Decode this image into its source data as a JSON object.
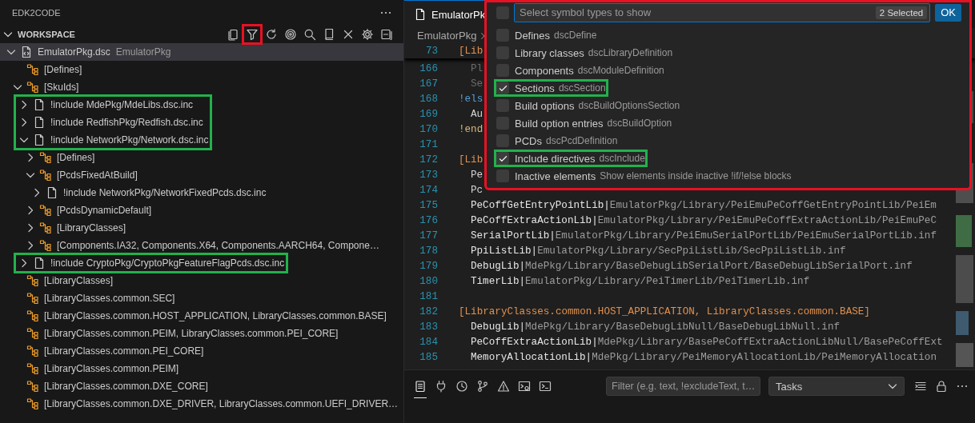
{
  "sidebar": {
    "title": "EDK2CODE",
    "section": {
      "title": "WORKSPACE",
      "expanded": true
    },
    "toolbar": [
      {
        "kind": "copy"
      },
      {
        "kind": "filter",
        "color": "#e81123"
      },
      {
        "kind": "refresh"
      },
      {
        "kind": "target"
      },
      {
        "kind": "search"
      },
      {
        "kind": "book"
      },
      {
        "kind": "close"
      },
      {
        "kind": "settings"
      },
      {
        "kind": "collapse"
      }
    ],
    "tree": [
      {
        "kind": "dsc",
        "label": "EmulatorPkg.dsc",
        "description": "EmulatorPkg",
        "expanded": true,
        "selected": true,
        "children": [
          {
            "kind": "section",
            "label": "[Defines]",
            "selected": false
          },
          {
            "kind": "section",
            "label": "[SkuIds]",
            "expanded": true,
            "selected": false,
            "children": [
              {
                "kind": "include",
                "label": "!include MdePkg/MdeLibs.dsc.inc",
                "expanded": false,
                "selected": false,
                "color": "#22b14c"
              },
              {
                "kind": "include",
                "label": "!include RedfishPkg/Redfish.dsc.inc",
                "expanded": false,
                "selected": false,
                "color": "#22b14c"
              },
              {
                "kind": "include",
                "label": "!include NetworkPkg/Network.dsc.inc",
                "expanded": true,
                "selected": false,
                "color": "#22b14c",
                "children": [
                  {
                    "kind": "section",
                    "label": "[Defines]",
                    "expanded": false,
                    "selected": false
                  },
                  {
                    "kind": "section",
                    "label": "[PcdsFixedAtBuild]",
                    "expanded": true,
                    "selected": false,
                    "children": [
                      {
                        "kind": "include",
                        "label": "!include NetworkPkg/NetworkFixedPcds.dsc.inc",
                        "expanded": false,
                        "selected": false
                      }
                    ]
                  },
                  {
                    "kind": "section",
                    "label": "[PcdsDynamicDefault]",
                    "expanded": false,
                    "selected": false
                  },
                  {
                    "kind": "section",
                    "label": "[LibraryClasses]",
                    "expanded": false,
                    "selected": false
                  },
                  {
                    "kind": "section",
                    "label": "[Components.IA32, Components.X64, Components.AARCH64, Compone…",
                    "expanded": false,
                    "selected": false
                  }
                ]
              },
              {
                "kind": "include",
                "label": "!include CryptoPkg/CryptoPkgFeatureFlagPcds.dsc.inc",
                "expanded": false,
                "selected": false,
                "color": "#22b14c"
              }
            ]
          },
          {
            "kind": "section",
            "label": "[LibraryClasses]",
            "selected": false
          },
          {
            "kind": "section",
            "label": "[LibraryClasses.common.SEC]",
            "selected": false
          },
          {
            "kind": "section",
            "label": "[LibraryClasses.common.HOST_APPLICATION, LibraryClasses.common.BASE]",
            "selected": false
          },
          {
            "kind": "section",
            "label": "[LibraryClasses.common.PEIM, LibraryClasses.common.PEI_CORE]",
            "selected": false
          },
          {
            "kind": "section",
            "label": "[LibraryClasses.common.PEI_CORE]",
            "selected": false
          },
          {
            "kind": "section",
            "label": "[LibraryClasses.common.PEIM]",
            "selected": false
          },
          {
            "kind": "section",
            "label": "[LibraryClasses.common.DXE_CORE]",
            "selected": false
          },
          {
            "kind": "section",
            "label": "[LibraryClasses.common.DXE_DRIVER, LibraryClasses.common.UEFI_DRIVER…",
            "selected": false
          }
        ]
      }
    ]
  },
  "editor": {
    "tab": "EmulatorPk",
    "breadcrumb": "EmulatorPkg",
    "sticky_line": {
      "num": "73",
      "kind": "section",
      "text": "[Lib"
    },
    "lines": [
      {
        "num": "166",
        "kind": "inactive",
        "text": "Pl"
      },
      {
        "num": "167",
        "kind": "inactive",
        "text": "Se"
      },
      {
        "num": "168",
        "kind": "directive",
        "text": "!els",
        "color": "#569cd6"
      },
      {
        "num": "169",
        "kind": "plain",
        "text": "Au"
      },
      {
        "num": "170",
        "kind": "directive",
        "text": "!end",
        "color": "#d7ba7d"
      },
      {
        "num": "171",
        "kind": "blank"
      },
      {
        "num": "172",
        "kind": "section",
        "text": "[Lib"
      },
      {
        "num": "173",
        "kind": "plain",
        "text": "Pe"
      },
      {
        "num": "174",
        "kind": "plain",
        "text": "Pc"
      },
      {
        "num": "175",
        "kind": "entry",
        "key": "PeCoffGetEntryPointLib|",
        "path": "EmulatorPkg/Library/PeiEmuPeCoffGetEntryPointLib/PeiEm"
      },
      {
        "num": "176",
        "kind": "entry",
        "key": "PeCoffExtraActionLib|",
        "path": "EmulatorPkg/Library/PeiEmuPeCoffExtraActionLib/PeiEmuPeC"
      },
      {
        "num": "177",
        "kind": "entry",
        "key": "SerialPortLib|",
        "path": "EmulatorPkg/Library/PeiEmuSerialPortLib/PeiEmuSerialPortLib.inf"
      },
      {
        "num": "178",
        "kind": "entry",
        "key": "PpiListLib|",
        "path": "EmulatorPkg/Library/SecPpiListLib/SecPpiListLib.inf"
      },
      {
        "num": "179",
        "kind": "entry",
        "key": "DebugLib|",
        "path": "MdePkg/Library/BaseDebugLibSerialPort/BaseDebugLibSerialPort.inf"
      },
      {
        "num": "180",
        "kind": "entry",
        "key": "TimerLib|",
        "path": "EmulatorPkg/Library/PeiTimerLib/PeiTimerLib.inf"
      },
      {
        "num": "181",
        "kind": "blank"
      },
      {
        "num": "182",
        "kind": "section",
        "text": "[LibraryClasses.common.HOST_APPLICATION, LibraryClasses.common.BASE]"
      },
      {
        "num": "183",
        "kind": "entry",
        "key": "DebugLib|",
        "path": "MdePkg/Library/BaseDebugLibNull/BaseDebugLibNull.inf"
      },
      {
        "num": "184",
        "kind": "entry",
        "key": "PeCoffExtraActionLib|",
        "path": "MdePkg/Library/BasePeCoffExtraActionLibNull/BasePeCoffExt"
      },
      {
        "num": "185",
        "kind": "entry",
        "key": "MemoryAllocationLib|",
        "path": "MdePkg/Library/PeiMemoryAllocationLib/PeiMemoryAllocation"
      }
    ]
  },
  "symbol_picker": {
    "color": "#e81123",
    "select_all": {
      "checked": false
    },
    "placeholder": "Select symbol types to show",
    "count": "2 Selected",
    "ok": "OK",
    "options": [
      {
        "label": "Defines",
        "description": "dscDefine",
        "checked": false
      },
      {
        "label": "Library classes",
        "description": "dscLibraryDefinition",
        "checked": false
      },
      {
        "label": "Components",
        "description": "dscModuleDefinition",
        "checked": false
      },
      {
        "label": "Sections",
        "description": "dscSection",
        "checked": true,
        "color": "#22b14c"
      },
      {
        "label": "Build options",
        "description": "dscBuildOptionsSection",
        "checked": false
      },
      {
        "label": "Build option entries",
        "description": "dscBuildOption",
        "checked": false
      },
      {
        "label": "PCDs",
        "description": "dscPcdDefinition",
        "checked": false
      },
      {
        "label": "Include directives",
        "description": "dscInclude",
        "checked": true,
        "color": "#22b14c"
      },
      {
        "label": "Inactive elements",
        "description": "Show elements inside inactive !if/!else blocks",
        "checked": false
      }
    ]
  },
  "panel": {
    "tabs": [
      {
        "kind": "output",
        "selected": true
      },
      {
        "kind": "ports",
        "selected": false
      },
      {
        "kind": "timeline",
        "selected": false
      },
      {
        "kind": "branch",
        "selected": false
      },
      {
        "kind": "problems",
        "selected": false
      },
      {
        "kind": "debug",
        "selected": false
      },
      {
        "kind": "terminal",
        "selected": false
      }
    ],
    "filter_placeholder": "Filter (e.g. text, !excludeText, t…",
    "dropdown": "Tasks"
  }
}
